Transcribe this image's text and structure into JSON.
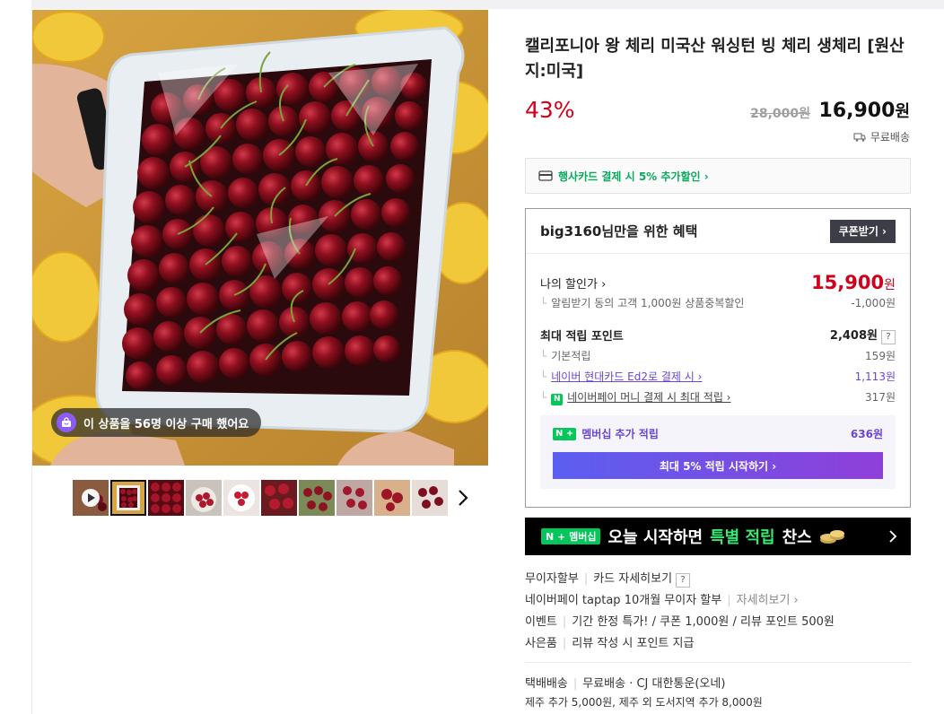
{
  "gallery": {
    "buyers_text": "이 상품을 56명 이상 구매 했어요",
    "thumbnail_count": 10
  },
  "product": {
    "title": "캘리포니아 왕 체리 미국산 워싱턴 빙 체리 생체리 [원산지:미국]",
    "discount_rate": "43%",
    "original_price": "28,000원",
    "sale_price": "16,900",
    "currency": "원",
    "shipping": "무료배송"
  },
  "card_banner": "행사카드 결제 시 5% 추가할인 ›",
  "benefit": {
    "title": "big3160님만을 위한 혜택",
    "coupon_button": "쿠폰받기 ›",
    "my_discount_label": "나의 할인가 ›",
    "my_discount_price": "15,900",
    "my_discount_currency": "원",
    "alarm_label": "알림받기 동의 고객 1,000원 상품중복할인",
    "alarm_value": "-1,000원",
    "max_points_label": "최대 적립 포인트",
    "max_points_value": "2,408원",
    "qmark": "?",
    "basic_label": "기본적립",
    "basic_value": "159원",
    "card_label": "네이버 현대카드 Ed2로 결제 시 ›",
    "card_value": "1,113원",
    "npay_label": "네이버페이 머니 결제 시 최대 적립 ›",
    "npay_value": "317원",
    "npay_icon": "N",
    "membership_badge": "N +",
    "membership_label": "멤버십 추가 적립",
    "membership_value": "636원",
    "start_button": "최대 5% 적립 시작하기 ›"
  },
  "promo": {
    "badge": "N + 멤버십",
    "text_before": "오늘 시작하면",
    "text_highlight": "특별 적립",
    "text_after": "찬스"
  },
  "info": {
    "installment_key": "무이자할부",
    "installment_link": "카드 자세히보기",
    "qmark": "?",
    "npay_installment": "네이버페이 taptap 10개월 무이자 할부",
    "npay_installment_link": "자세히보기 ›",
    "event_key": "이벤트",
    "event_value": "기간 한정 특가! / 쿠폰 1,000원 / 리뷰 포인트 500원",
    "gift_key": "사은품",
    "gift_value": "리뷰 작성 시 포인트 지급",
    "delivery_key": "택배배송",
    "delivery_value": "무료배송 · CJ 대한통운(오네)",
    "delivery_extra": "제주 추가 5,000원, 제주 외 도서지역 추가 8,000원"
  },
  "colors": {
    "accent_red": "#d0021b",
    "naver_green": "#03c75a",
    "purple": "#6a45d6"
  }
}
